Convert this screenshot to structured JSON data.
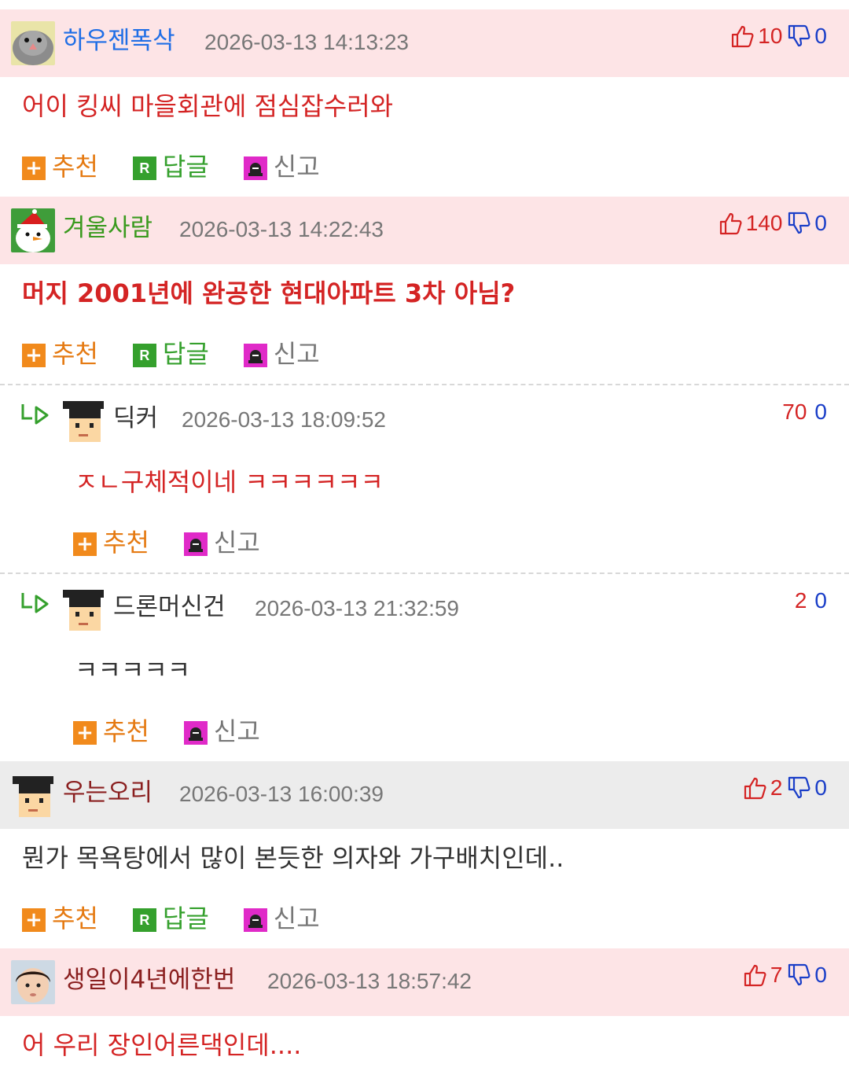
{
  "actions": {
    "recommend": "추천",
    "reply": "답글",
    "report": "신고",
    "reply_box_letter": "R"
  },
  "comments": [
    {
      "nick": "하우젠폭삭",
      "date": "2026-03-13 14:13:23",
      "up": "10",
      "down": "0",
      "text": "어이 킹씨 마을회관에 점심잡수러와",
      "avatar": "bird-avatar"
    },
    {
      "nick": "겨울사람",
      "date": "2026-03-13 14:22:43",
      "up": "140",
      "down": "0",
      "text": "머지 2001년에 완공한 현대아파트 3차 아님?",
      "avatar": "snowman-avatar"
    },
    {
      "nick": "딕커",
      "date": "2026-03-13 18:09:52",
      "up": "70",
      "down": "0",
      "text": "ㅈㄴ구체적이네 ㅋㅋㅋㅋㅋㅋ",
      "avatar": "grad-cap-avatar"
    },
    {
      "nick": "드론머신건",
      "date": "2026-03-13 21:32:59",
      "up": "2",
      "down": "0",
      "text": "ㅋㅋㅋㅋㅋ",
      "avatar": "grad-cap-avatar"
    },
    {
      "nick": "우는오리",
      "date": "2026-03-13 16:00:39",
      "up": "2",
      "down": "0",
      "text": "뭔가 목욕탕에서 많이 본듯한 의자와 가구배치인데..",
      "avatar": "grad-cap-avatar"
    },
    {
      "nick": "생일이4년에한번",
      "date": "2026-03-13 18:57:42",
      "up": "7",
      "down": "0",
      "text": "어 우리 장인어른댁인데....",
      "avatar": "child-photo-avatar"
    }
  ],
  "colors": {
    "pink_header": "#fde4e6",
    "gray_header": "#ececec",
    "red": "#d42424",
    "blue": "#1a3ec8",
    "green": "#35a02d",
    "orange": "#f18a1c"
  }
}
